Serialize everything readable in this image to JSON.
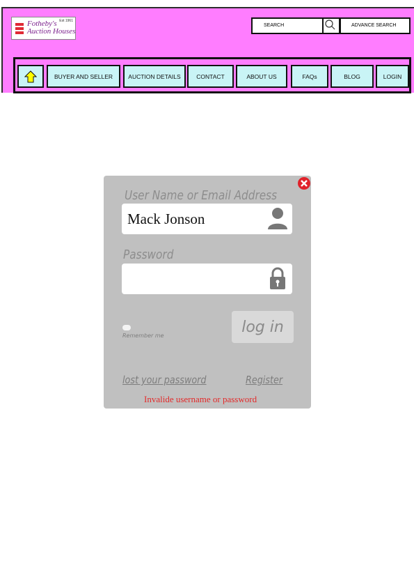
{
  "header": {
    "logo": {
      "line1": "Fotheby's",
      "line2": "Auction Houses",
      "est": "Est 1961"
    },
    "search": {
      "placeholder": "SEARCH",
      "advanced_label": "ADVANCE SEARCH"
    },
    "nav": [
      {
        "id": "home",
        "label": ""
      },
      {
        "id": "buyer-seller",
        "label": "BUYER AND SELLER"
      },
      {
        "id": "auction-details",
        "label": "AUCTION DETAILS"
      },
      {
        "id": "contact",
        "label": "CONTACT"
      },
      {
        "id": "about",
        "label": "ABOUT US"
      },
      {
        "id": "faqs",
        "label": "FAQs"
      },
      {
        "id": "blog",
        "label": "BLOG"
      },
      {
        "id": "login",
        "label": "LOGIN"
      }
    ]
  },
  "login": {
    "username_label": "User Name or Email Address",
    "username_value": "Mack Jonson",
    "password_label": "Password",
    "password_value": "",
    "remember_label": "Remember me",
    "login_button": "log in",
    "lost_password": "lost your password",
    "register": "Register",
    "error_message": "Invalide username or password",
    "icons": [
      "user-icon",
      "lock-icon",
      "close-icon",
      "home-arrow-icon",
      "search-icon"
    ]
  },
  "colors": {
    "header_bg": "#ff7dff",
    "nav_item_bg": "#c9f4f6",
    "panel_bg": "#c0c0c0",
    "error": "#e32a2a",
    "close": "#e0222a"
  }
}
